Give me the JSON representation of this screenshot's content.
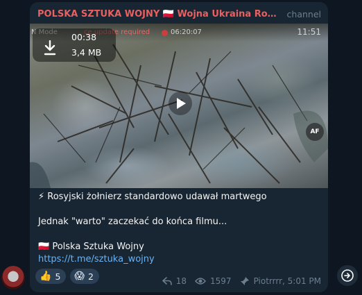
{
  "post": {
    "channel_name": "POLSKA SZTUKA WOJNY 🇵🇱 Wojna Ukraina Rosja Izra...",
    "channel_tag": "channel",
    "video": {
      "duration": "00:38",
      "size": "3,4 MB",
      "hud_mode": "N Mode",
      "hud_update": "ce update required",
      "hud_clock": "06:20:07",
      "hud_right": "11:51",
      "badge": "AF"
    },
    "text": {
      "line1": "⚡ Rosyjski żołnierz standardowo udawał martwego",
      "line2": "Jednak \"warto\" zaczekać do końca filmu...",
      "line3": "🇵🇱 Polska Sztuka Wojny",
      "link": "https://t.me/sztuka_wojny"
    },
    "reactions": [
      {
        "emoji": "👍",
        "count": "5"
      },
      {
        "emoji": "😱",
        "count": "2"
      }
    ],
    "meta": {
      "shares": "18",
      "views": "1597",
      "author_time": "Piotrrrr, 5:01 PM"
    }
  },
  "colors": {
    "background": "#0e1621",
    "bubble": "#182533",
    "channel_name": "#e8605f",
    "link": "#6ab3f3",
    "meta": "#6d7f8f"
  }
}
